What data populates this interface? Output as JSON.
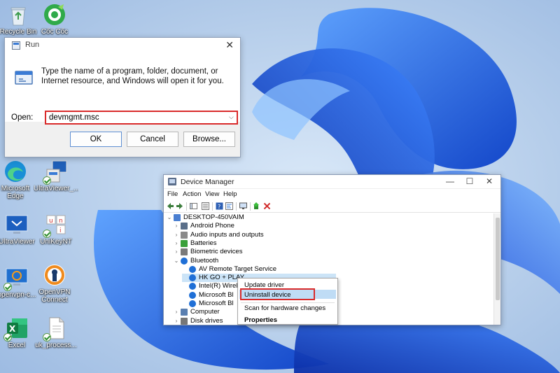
{
  "desktop": {
    "icons": [
      {
        "label": "Recycle Bin",
        "icon": "recycle-bin-icon"
      },
      {
        "label": "Cốc Cốc",
        "icon": "coccoc-browser-icon"
      },
      {
        "label": "Microsoft Edge",
        "icon": "edge-icon"
      },
      {
        "label": "UltraViewer_...",
        "icon": "ultraviewer-setup-icon"
      },
      {
        "label": "UltraViewer",
        "icon": "ultraviewer-icon"
      },
      {
        "label": "UniKeyNT",
        "icon": "unikey-icon"
      },
      {
        "label": "openvpn-c...",
        "icon": "openvpn-setup-icon"
      },
      {
        "label": "OpenVPN Connect",
        "icon": "openvpn-icon"
      },
      {
        "label": "Excel",
        "icon": "excel-icon"
      },
      {
        "label": "uk_process...",
        "icon": "document-icon"
      }
    ]
  },
  "run_dialog": {
    "title": "Run",
    "description": "Type the name of a program, folder, document, or Internet resource, and Windows will open it for you.",
    "open_label": "Open:",
    "open_value": "devmgmt.msc",
    "ok_label": "OK",
    "cancel_label": "Cancel",
    "browse_label": "Browse...",
    "close_glyph": "✕"
  },
  "device_manager": {
    "title": "Device Manager",
    "menu": [
      "File",
      "Action",
      "View",
      "Help"
    ],
    "minimize_glyph": "—",
    "maximize_glyph": "☐",
    "close_glyph": "✕",
    "tree": [
      {
        "label": "DESKTOP-450VAIM",
        "expander": "⌄"
      },
      {
        "label": "Android Phone",
        "expander": "›"
      },
      {
        "label": "Audio inputs and outputs",
        "expander": "›"
      },
      {
        "label": "Batteries",
        "expander": "›"
      },
      {
        "label": "Biometric devices",
        "expander": "›"
      },
      {
        "label": "Bluetooth",
        "expander": "⌄"
      },
      {
        "label": "AV Remote Target Service",
        "expander": ""
      },
      {
        "label": "HK GO + PLAY",
        "expander": ""
      },
      {
        "label": "Intel(R) Wireless",
        "expander": ""
      },
      {
        "label": "Microsoft Bl",
        "expander": ""
      },
      {
        "label": "Microsoft Bl",
        "expander": ""
      },
      {
        "label": "Computer",
        "expander": "›"
      },
      {
        "label": "Disk drives",
        "expander": "›"
      }
    ]
  },
  "context_menu": {
    "items": [
      "Update driver",
      "Uninstall device",
      "Scan for hardware changes",
      "Properties"
    ],
    "highlighted": "Uninstall device"
  },
  "colors": {
    "highlight_box": "#d92b2b",
    "selection": "#cce4f7",
    "accent": "#1f5bd6"
  }
}
